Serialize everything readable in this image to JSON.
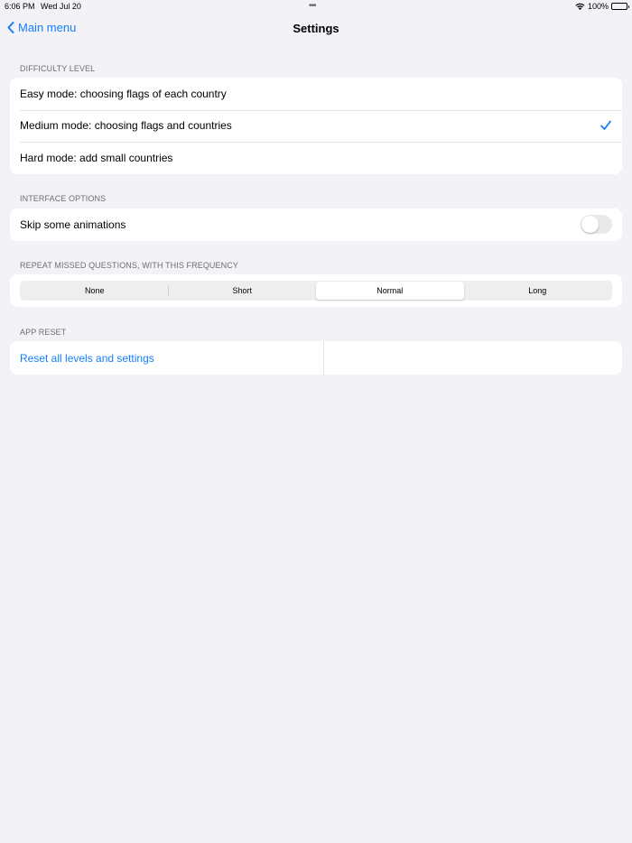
{
  "status_bar": {
    "time": "6:06 PM",
    "date": "Wed Jul 20",
    "multitask_dots": "•••",
    "battery": "100%"
  },
  "nav": {
    "back_label": "Main menu",
    "title": "Settings"
  },
  "difficulty": {
    "header": "DIFFICULTY LEVEL",
    "options": [
      {
        "label": "Easy mode: choosing flags of each country",
        "selected": false
      },
      {
        "label": "Medium mode: choosing flags and countries",
        "selected": true
      },
      {
        "label": "Hard mode: add small countries",
        "selected": false
      }
    ]
  },
  "interface": {
    "header": "INTERFACE OPTIONS",
    "skip_animations_label": "Skip some animations",
    "skip_animations_on": false
  },
  "repeat": {
    "header": "REPEAT MISSED QUESTIONS, WITH THIS FREQUENCY",
    "segments": [
      "None",
      "Short",
      "Normal",
      "Long"
    ],
    "selected": "Normal"
  },
  "reset": {
    "header": "APP RESET",
    "link_label": "Reset all levels and settings"
  },
  "colors": {
    "accent": "#147efb",
    "background": "#f2f2f7"
  }
}
